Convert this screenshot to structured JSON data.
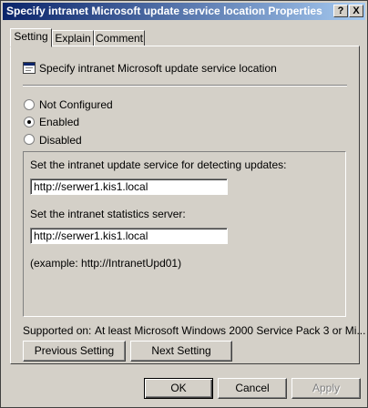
{
  "window": {
    "title": "Specify intranet Microsoft update service location Properties",
    "help_button": "?",
    "close_button": "X"
  },
  "tabs": [
    {
      "label": "Setting",
      "active": true
    },
    {
      "label": "Explain",
      "active": false
    },
    {
      "label": "Comment",
      "active": false
    }
  ],
  "policy": {
    "icon": "policy-setting-icon",
    "name": "Specify intranet Microsoft update service location"
  },
  "options": {
    "not_configured": "Not Configured",
    "enabled": "Enabled",
    "disabled": "Disabled",
    "selected": "Enabled"
  },
  "fields": {
    "update_service_label": "Set the intranet update service for detecting updates:",
    "update_service_value": "http://serwer1.kis1.local",
    "statistics_label": "Set the intranet statistics server:",
    "statistics_value": "http://serwer1.kis1.local",
    "example": "(example: http://IntranetUpd01)"
  },
  "supported": {
    "label": "Supported on:",
    "value": "At least Microsoft Windows 2000 Service Pack 3 or Mi..."
  },
  "nav": {
    "previous": "Previous Setting",
    "next": "Next Setting"
  },
  "footer": {
    "ok": "OK",
    "cancel": "Cancel",
    "apply": "Apply"
  }
}
